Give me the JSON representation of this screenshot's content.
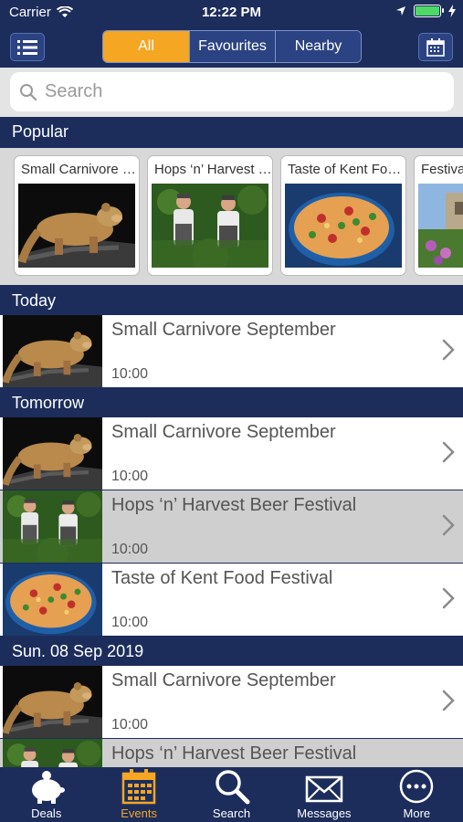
{
  "status": {
    "carrier": "Carrier",
    "time": "12:22 PM"
  },
  "nav": {
    "segments": [
      "All",
      "Favourites",
      "Nearby"
    ],
    "active_segment": "All",
    "left_icon": "list-icon",
    "right_icon": "calendar-icon"
  },
  "search": {
    "placeholder": "Search"
  },
  "sections": {
    "popular": "Popular",
    "today": "Today",
    "tomorrow": "Tomorrow",
    "sun": "Sun. 08 Sep 2019"
  },
  "popular": [
    {
      "title": "Small Carnivore September",
      "image": "carnivore"
    },
    {
      "title": "Hops ‘n’ Harvest Beer Festival",
      "image": "farmers"
    },
    {
      "title": "Taste of Kent Food Festival",
      "image": "food"
    },
    {
      "title": "Festival",
      "image": "garden"
    }
  ],
  "today": [
    {
      "title": "Small Carnivore September",
      "time": "10:00",
      "image": "carnivore"
    }
  ],
  "tomorrow": [
    {
      "title": "Small Carnivore September",
      "time": "10:00",
      "image": "carnivore"
    },
    {
      "title": "Hops ‘n’ Harvest Beer Festival",
      "time": "10:00",
      "image": "farmers"
    },
    {
      "title": "Taste of Kent Food Festival",
      "time": "10:00",
      "image": "food"
    }
  ],
  "sun": [
    {
      "title": "Small Carnivore September",
      "time": "10:00",
      "image": "carnivore"
    },
    {
      "title": "Hops ‘n’ Harvest Beer Festival",
      "time": "",
      "image": "farmers"
    }
  ],
  "tabs": [
    {
      "label": "Deals",
      "icon": "piggy-bank-icon"
    },
    {
      "label": "Events",
      "icon": "calendar-icon",
      "active": true
    },
    {
      "label": "Search",
      "icon": "search-icon"
    },
    {
      "label": "Messages",
      "icon": "envelope-icon"
    },
    {
      "label": "More",
      "icon": "more-icon"
    }
  ],
  "colors": {
    "navy": "#1c2d5c",
    "accent": "#f5a623",
    "row_alt": "#cfcfcf"
  }
}
